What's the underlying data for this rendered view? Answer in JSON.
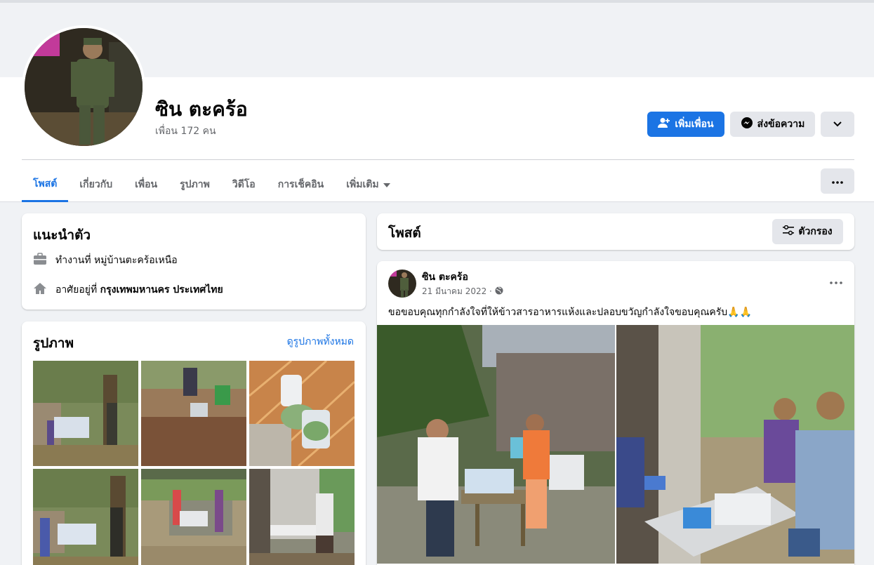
{
  "profile": {
    "name": "ซิน ตะคร้อ",
    "friends": "เพื่อน 172 คน"
  },
  "actions": {
    "add_friend": "เพิ่มเพื่อน",
    "message": "ส่งข้อความ"
  },
  "tabs": [
    {
      "label": "โพสต์"
    },
    {
      "label": "เกี่ยวกับ"
    },
    {
      "label": "เพื่อน"
    },
    {
      "label": "รูปภาพ"
    },
    {
      "label": "วิดีโอ"
    },
    {
      "label": "การเช็คอิน"
    },
    {
      "label": "เพิ่มเติม"
    }
  ],
  "intro": {
    "title": "แนะนำตัว",
    "work_prefix": "ทำงานที่ หมู่บ้านตะคร้อเหนือ",
    "lives_prefix": "อาศัยอยู่ที่ ",
    "lives_place": "กรุงเทพมหานคร ประเทศไทย"
  },
  "photos": {
    "title": "รูปภาพ",
    "see_all": "ดูรูปภาพทั้งหมด"
  },
  "posts_header": {
    "title": "โพสต์",
    "filter": "ตัวกรอง"
  },
  "post": {
    "author": "ซิน ตะคร้อ",
    "date": "21 มีนาคม 2022 ·",
    "text": "ขอขอบคุณทุกกำลังใจที่ให้ข้าวสารอาหารแห้งและปลอบขวัญกำลังใจขอบคุณครับ🙏🙏"
  },
  "colors": {
    "accent": "#1b74e4",
    "background": "#f0f2f5",
    "secondary_text": "#65676b"
  }
}
